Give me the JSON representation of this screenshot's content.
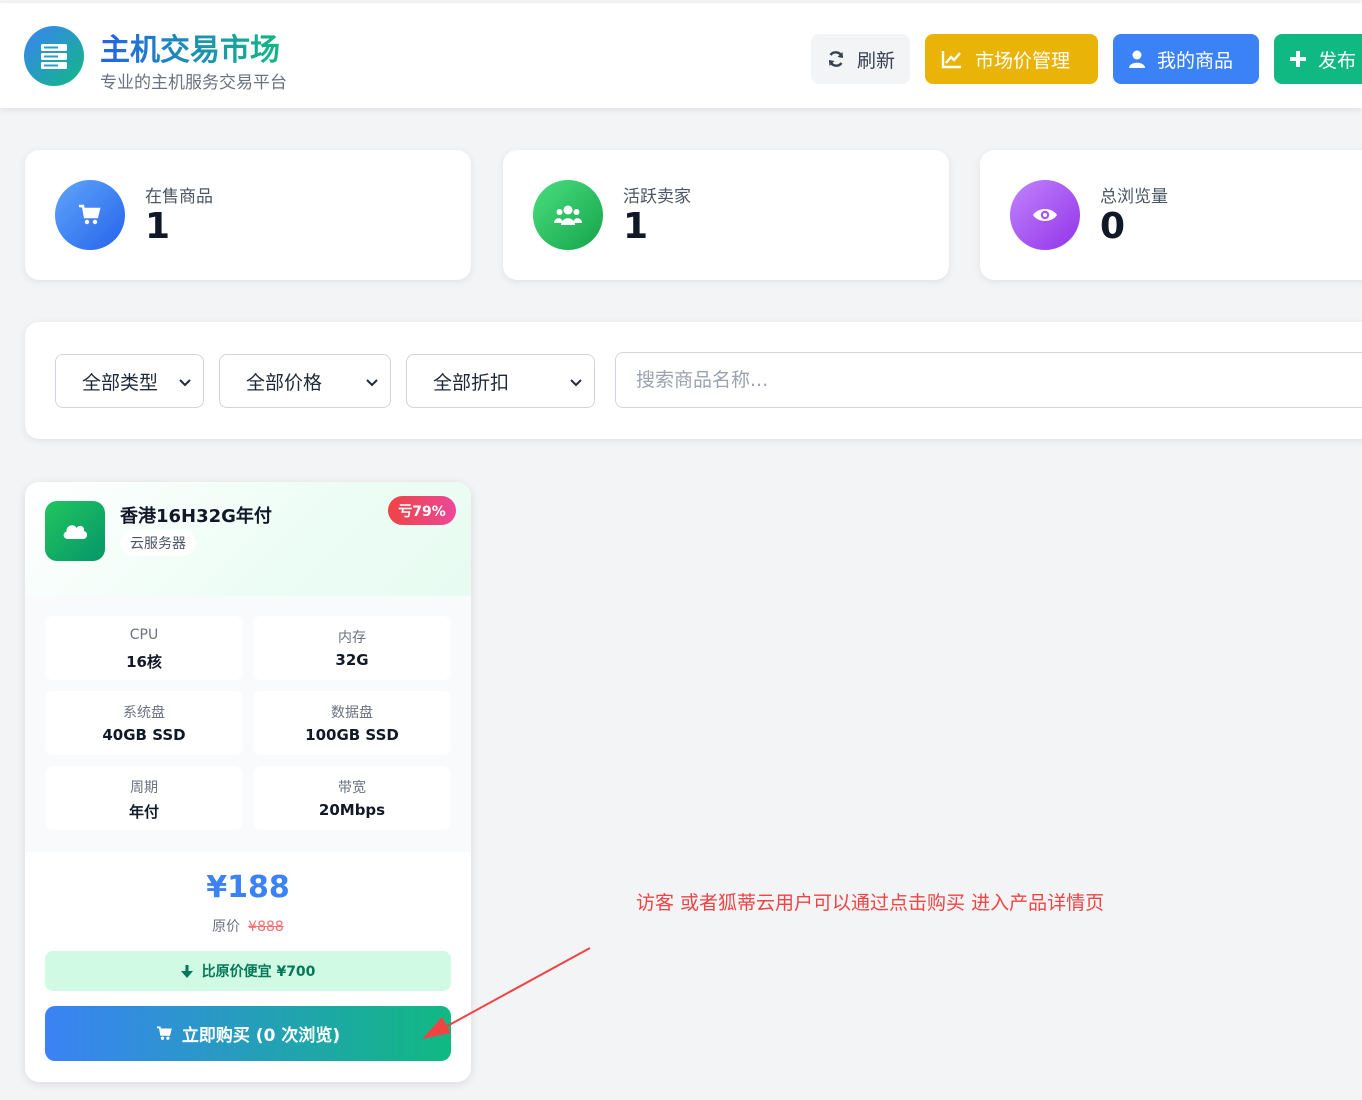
{
  "header": {
    "title": "主机交易市场",
    "subtitle": "专业的主机服务交易平台",
    "buttons": {
      "refresh": "刷新",
      "market": "市场价管理",
      "mine": "我的商品",
      "publish": "发布"
    }
  },
  "stats": [
    {
      "label": "在售商品",
      "value": "1",
      "icon": "cart-icon"
    },
    {
      "label": "活跃卖家",
      "value": "1",
      "icon": "users-icon"
    },
    {
      "label": "总浏览量",
      "value": "0",
      "icon": "eye-icon"
    }
  ],
  "filters": {
    "type": "全部类型",
    "price": "全部价格",
    "discount": "全部折扣",
    "search_placeholder": "搜索商品名称..."
  },
  "product": {
    "name": "香港16H32G年付",
    "tag": "云服务器",
    "discount": "亏79%",
    "specs": [
      {
        "label": "CPU",
        "value": "16核"
      },
      {
        "label": "内存",
        "value": "32G"
      },
      {
        "label": "系统盘",
        "value": "40GB SSD"
      },
      {
        "label": "数据盘",
        "value": "100GB SSD"
      },
      {
        "label": "周期",
        "value": "年付"
      },
      {
        "label": "带宽",
        "value": "20Mbps"
      }
    ],
    "price": "¥188",
    "original_label": "原价",
    "original_price": "¥888",
    "savings": "比原价便宜 ¥700",
    "buy_label": "立即购买 (0 次浏览)"
  },
  "annotation": "访客 或者狐蒂云用户可以通过点击购买 进入产品详情页",
  "colors": {
    "primary": "#3b82f6",
    "success": "#10b981",
    "warning": "#eab308",
    "danger": "#ef4444"
  }
}
